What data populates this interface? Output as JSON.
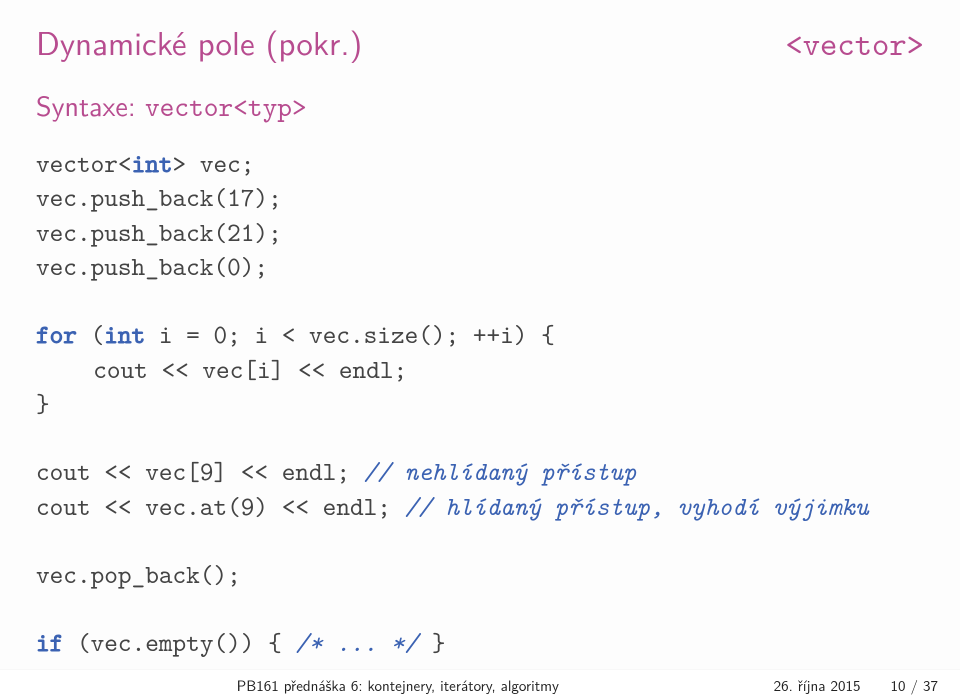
{
  "header": {
    "title_left": "Dynamické pole (pokr.)",
    "title_right": "<vector>"
  },
  "subtitle": {
    "prefix": "Syntaxe: ",
    "tt": "vector<typ>"
  },
  "code": {
    "l1a": "vector<",
    "l1b": "int",
    "l1c": "> vec;",
    "l2a": "vec.push_back(",
    "l2n": "17",
    "l2b": ");",
    "l3a": "vec.push_back(",
    "l3n": "21",
    "l3b": ");",
    "l4a": "vec.push_back(",
    "l4n": "0",
    "l4b": ");",
    "l5a": "for",
    "l5b": " (",
    "l5c": "int",
    "l5d": " i = ",
    "l5n1": "0",
    "l5e": "; i < vec.size(); ++i) {",
    "l6": "cout << vec[i] << endl;",
    "l7": "}",
    "l8a": "cout << vec[",
    "l8n": "9",
    "l8b": "] << endl; ",
    "l8c": "// nehlídaný přístup",
    "l9a": "cout << vec.at(",
    "l9n": "9",
    "l9b": ") << endl; ",
    "l9c": "// hlídaný přístup, vyhodí výjimku",
    "l10": "vec.pop_back();",
    "l11a": "if",
    "l11b": " (vec.empty()) { ",
    "l11c": "/* ... */",
    "l11d": " }"
  },
  "footer": {
    "center": "PB161 přednáška 6: kontejnery, iterátory, algoritmy",
    "date": "26. října 2015",
    "page": "10 / 37"
  }
}
